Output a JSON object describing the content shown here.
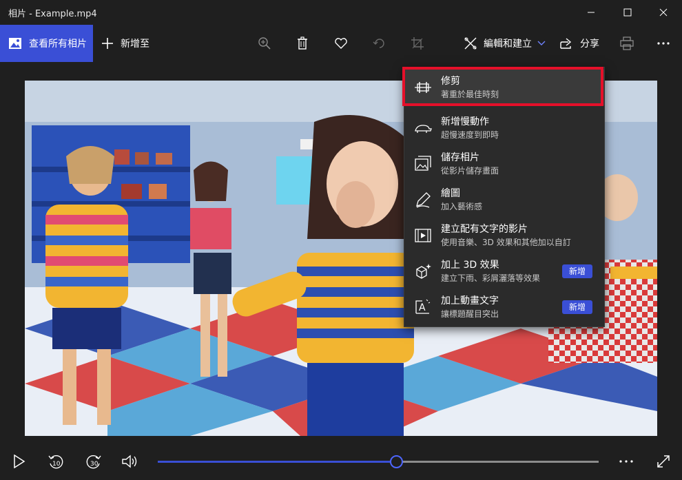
{
  "window": {
    "title": "相片 - Example.mp4"
  },
  "toolbar": {
    "see_all_label": "查看所有相片",
    "add_to_label": "新增至",
    "edit_create_label": "編輯和建立",
    "share_label": "分享"
  },
  "menu": {
    "items": [
      {
        "title": "修剪",
        "subtitle": "著重於最佳時刻",
        "icon": "trim-icon",
        "badge": ""
      },
      {
        "title": "新增慢動作",
        "subtitle": "超慢速度到即時",
        "icon": "slow-motion-icon",
        "badge": ""
      },
      {
        "title": "儲存相片",
        "subtitle": "從影片儲存畫面",
        "icon": "save-photo-icon",
        "badge": ""
      },
      {
        "title": "繪圖",
        "subtitle": "加入藝術感",
        "icon": "draw-icon",
        "badge": ""
      },
      {
        "title": "建立配有文字的影片",
        "subtitle": "使用音樂、3D 效果和其他加以自訂",
        "icon": "video-text-icon",
        "badge": ""
      },
      {
        "title": "加上 3D 效果",
        "subtitle": "建立下雨、彩屑灑落等效果",
        "icon": "3d-effects-icon",
        "badge": "新增"
      },
      {
        "title": "加上動畫文字",
        "subtitle": "讓標題醒目突出",
        "icon": "animated-text-icon",
        "badge": "新增"
      }
    ]
  },
  "player": {
    "rewind_label": "10",
    "forward_label": "30",
    "progress_fraction": 0.54
  },
  "colors": {
    "accent": "#3a4fd6",
    "highlight_box": "#e5102a",
    "background": "#1f1f1f",
    "menu_bg": "#2b2b2b"
  }
}
